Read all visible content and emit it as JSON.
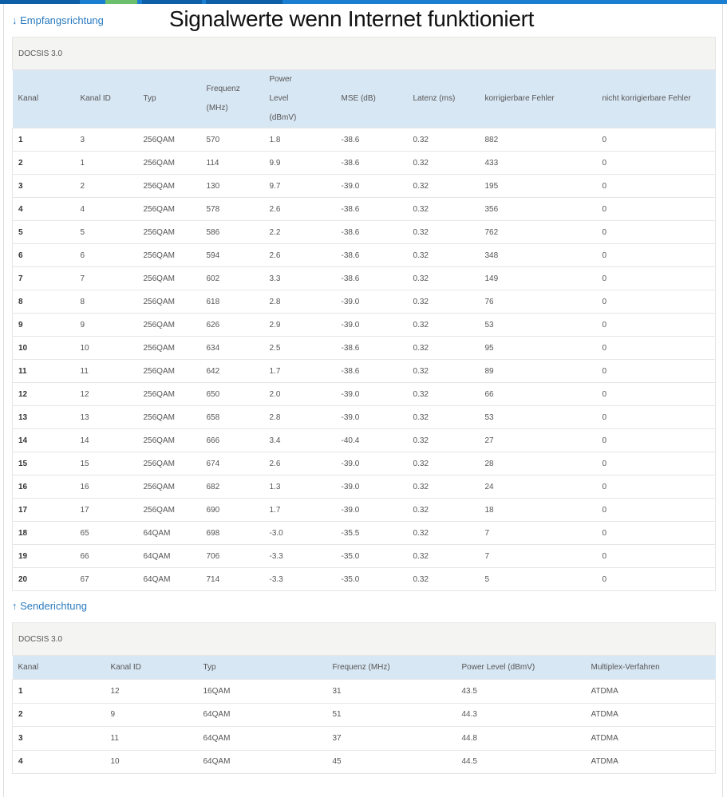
{
  "headline": "Signalwerte wenn Internet funktioniert",
  "downstream": {
    "title": "↓ Empfangsrichtung",
    "docsis": "DOCSIS 3.0",
    "headers": [
      "Kanal",
      "Kanal ID",
      "Typ",
      "Frequenz (MHz)",
      "Power Level (dBmV)",
      "MSE (dB)",
      "Latenz (ms)",
      "korrigierbare Fehler",
      "nicht korrigierbare Fehler"
    ],
    "rows": [
      [
        "1",
        "3",
        "256QAM",
        "570",
        "1.8",
        "-38.6",
        "0.32",
        "882",
        "0"
      ],
      [
        "2",
        "1",
        "256QAM",
        "114",
        "9.9",
        "-38.6",
        "0.32",
        "433",
        "0"
      ],
      [
        "3",
        "2",
        "256QAM",
        "130",
        "9.7",
        "-39.0",
        "0.32",
        "195",
        "0"
      ],
      [
        "4",
        "4",
        "256QAM",
        "578",
        "2.6",
        "-38.6",
        "0.32",
        "356",
        "0"
      ],
      [
        "5",
        "5",
        "256QAM",
        "586",
        "2.2",
        "-38.6",
        "0.32",
        "762",
        "0"
      ],
      [
        "6",
        "6",
        "256QAM",
        "594",
        "2.6",
        "-38.6",
        "0.32",
        "348",
        "0"
      ],
      [
        "7",
        "7",
        "256QAM",
        "602",
        "3.3",
        "-38.6",
        "0.32",
        "149",
        "0"
      ],
      [
        "8",
        "8",
        "256QAM",
        "618",
        "2.8",
        "-39.0",
        "0.32",
        "76",
        "0"
      ],
      [
        "9",
        "9",
        "256QAM",
        "626",
        "2.9",
        "-39.0",
        "0.32",
        "53",
        "0"
      ],
      [
        "10",
        "10",
        "256QAM",
        "634",
        "2.5",
        "-38.6",
        "0.32",
        "95",
        "0"
      ],
      [
        "11",
        "11",
        "256QAM",
        "642",
        "1.7",
        "-38.6",
        "0.32",
        "89",
        "0"
      ],
      [
        "12",
        "12",
        "256QAM",
        "650",
        "2.0",
        "-39.0",
        "0.32",
        "66",
        "0"
      ],
      [
        "13",
        "13",
        "256QAM",
        "658",
        "2.8",
        "-39.0",
        "0.32",
        "53",
        "0"
      ],
      [
        "14",
        "14",
        "256QAM",
        "666",
        "3.4",
        "-40.4",
        "0.32",
        "27",
        "0"
      ],
      [
        "15",
        "15",
        "256QAM",
        "674",
        "2.6",
        "-39.0",
        "0.32",
        "28",
        "0"
      ],
      [
        "16",
        "16",
        "256QAM",
        "682",
        "1.3",
        "-39.0",
        "0.32",
        "24",
        "0"
      ],
      [
        "17",
        "17",
        "256QAM",
        "690",
        "1.7",
        "-39.0",
        "0.32",
        "18",
        "0"
      ],
      [
        "18",
        "65",
        "64QAM",
        "698",
        "-3.0",
        "-35.5",
        "0.32",
        "7",
        "0"
      ],
      [
        "19",
        "66",
        "64QAM",
        "706",
        "-3.3",
        "-35.0",
        "0.32",
        "7",
        "0"
      ],
      [
        "20",
        "67",
        "64QAM",
        "714",
        "-3.3",
        "-35.0",
        "0.32",
        "5",
        "0"
      ]
    ]
  },
  "upstream": {
    "title": "↑ Senderichtung",
    "docsis": "DOCSIS 3.0",
    "headers": [
      "Kanal",
      "Kanal ID",
      "Typ",
      "Frequenz (MHz)",
      "Power Level (dBmV)",
      "Multiplex-Verfahren"
    ],
    "rows": [
      [
        "1",
        "12",
        "16QAM",
        "31",
        "43.5",
        "ATDMA"
      ],
      [
        "2",
        "9",
        "64QAM",
        "51",
        "44.3",
        "ATDMA"
      ],
      [
        "3",
        "11",
        "64QAM",
        "37",
        "44.8",
        "ATDMA"
      ],
      [
        "4",
        "10",
        "64QAM",
        "45",
        "44.5",
        "ATDMA"
      ]
    ]
  }
}
